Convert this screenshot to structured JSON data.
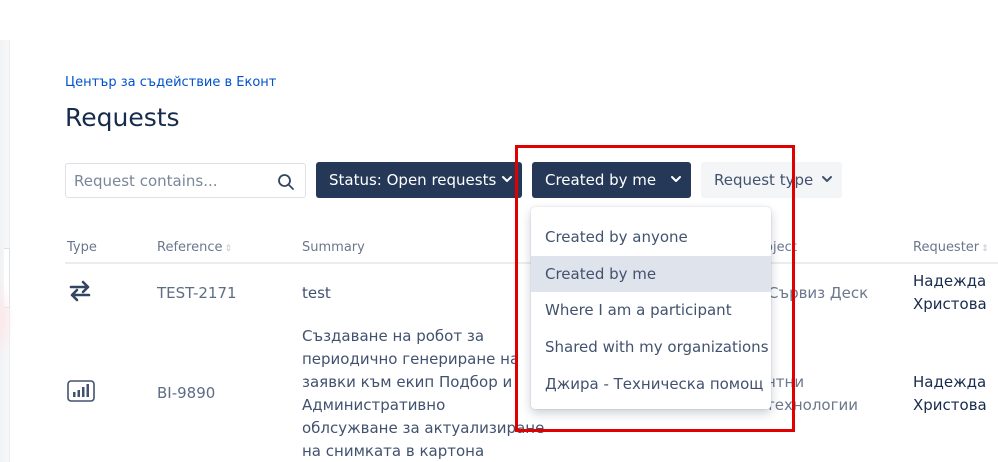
{
  "breadcrumb": "Център за съдействие в Еконт",
  "title": "Requests",
  "search": {
    "placeholder": "Request contains..."
  },
  "filters": {
    "status": "Status: Open requests",
    "created": "Created by me",
    "request_type": "Request type"
  },
  "dropdown": {
    "items": [
      {
        "label": "Created by anyone",
        "selected": false
      },
      {
        "label": "Created by me",
        "selected": true
      },
      {
        "label": "Where I am a participant",
        "selected": false
      },
      {
        "label": "Shared with my organizations",
        "selected": false
      },
      {
        "label": "Джира - Техническа помощ",
        "selected": false
      }
    ]
  },
  "table": {
    "headers": {
      "type": "Type",
      "reference": "Reference",
      "summary": "Summary",
      "project": "roject",
      "requester": "Requester"
    },
    "rows": [
      {
        "type_icon": "arrows-swap-icon",
        "reference": "TEST-2171",
        "summary": [
          "test"
        ],
        "project": [
          "Сървиз Деск"
        ],
        "requester": [
          "Надежда",
          "Христова"
        ]
      },
      {
        "type_icon": "bar-chart-icon",
        "reference": "BI-9890",
        "summary": [
          "Създаване на робот за",
          "периодично генериране на",
          "заявки към екип Подбор и",
          "Административно",
          "облсужване за актуализиране",
          "на снимката в картона"
        ],
        "project": [
          "нтни",
          "технологии"
        ],
        "requester": [
          "Надежда",
          "Христова"
        ]
      }
    ]
  },
  "colors": {
    "accent_dark": "#253858",
    "link": "#0052cc",
    "highlight": "#e00000"
  }
}
